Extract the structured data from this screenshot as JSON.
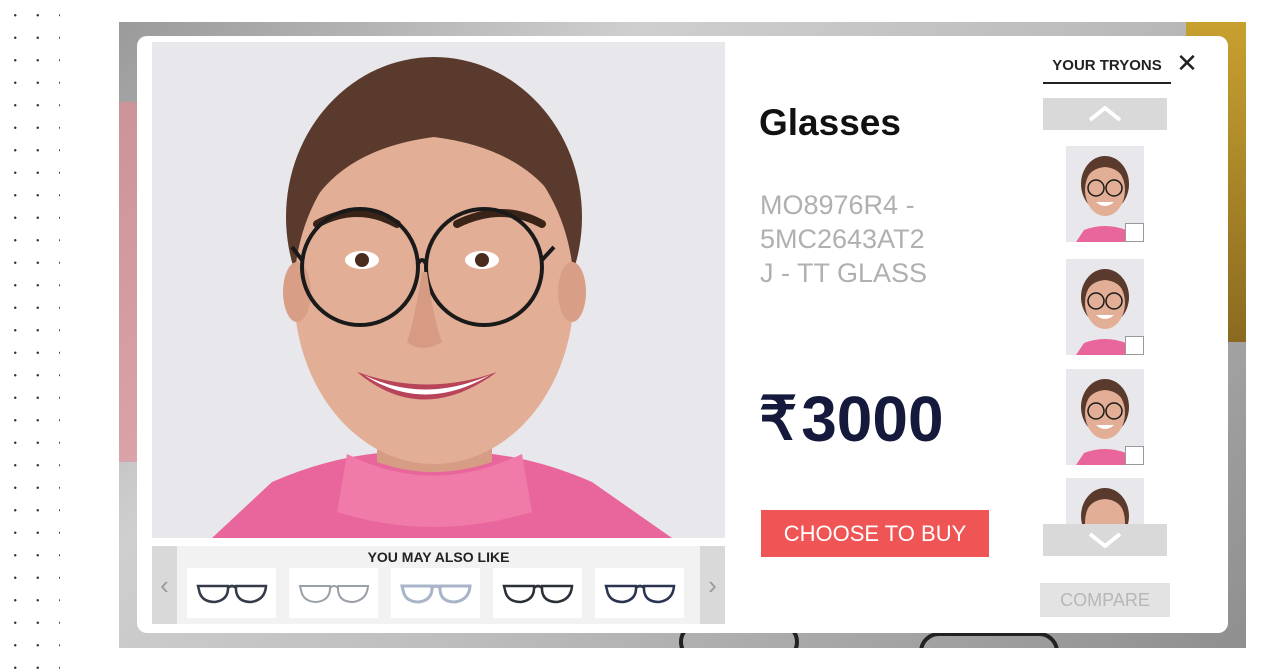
{
  "product": {
    "name": "Glasses",
    "code_line1": "MO8976R4 -",
    "code_line2": "5MC2643AT2",
    "code_line3": "J - TT GLASS",
    "currency_symbol": "₹",
    "price": "3000",
    "buy_label": "CHOOSE TO BUY"
  },
  "recommendations": {
    "title": "YOU MAY ALSO LIKE",
    "prev_icon": "chevron-left-icon",
    "next_icon": "chevron-right-icon",
    "items": [
      {
        "icon": "glasses-black-icon",
        "color": "#333a48"
      },
      {
        "icon": "glasses-silver-icon",
        "color": "#9aa0a8"
      },
      {
        "icon": "glasses-clear-icon",
        "color": "#a8b4c8"
      },
      {
        "icon": "glasses-dark-icon",
        "color": "#2a2f38"
      },
      {
        "icon": "glasses-navy-icon",
        "color": "#2a3350"
      }
    ]
  },
  "tryons": {
    "tab_label": "YOUR TRYONS",
    "close_icon": "close-icon",
    "up_icon": "chevron-up-icon",
    "down_icon": "chevron-down-icon",
    "compare_label": "COMPARE"
  },
  "colors": {
    "accent": "#ef5555",
    "price": "#151a3c",
    "sweater": "#e8669b"
  }
}
